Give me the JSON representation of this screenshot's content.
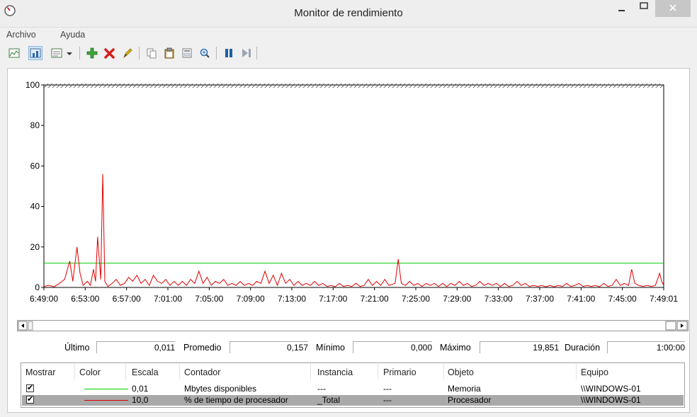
{
  "window": {
    "title": "Monitor de rendimiento"
  },
  "menu": [
    "Archivo",
    "Ayuda"
  ],
  "toolbar": {
    "icons": [
      "view-graph-icon",
      "view-histogram-icon",
      "view-report-icon",
      "dropdown-arrow-icon",
      "add-counter-icon",
      "delete-counter-icon",
      "highlight-icon",
      "copy-properties-icon",
      "paste-counter-list-icon",
      "properties-icon",
      "zoom-icon",
      "freeze-display-icon",
      "update-data-icon"
    ]
  },
  "chart_data": {
    "type": "line",
    "ylim": [
      0,
      100
    ],
    "yticks": [
      "0",
      "20",
      "40",
      "60",
      "80",
      "100"
    ],
    "xticks": [
      "6:49:00",
      "6:53:00",
      "6:57:00",
      "7:01:00",
      "7:05:00",
      "7:09:00",
      "7:13:00",
      "7:17:00",
      "7:21:00",
      "7:25:00",
      "7:29:00",
      "7:33:00",
      "7:37:00",
      "7:41:00",
      "7:45:00",
      "7:49:01"
    ],
    "series": [
      {
        "name": "Mbytes disponibles",
        "color": "#00cc00",
        "scale": "0,01",
        "values": [
          [
            0,
            12
          ],
          [
            60,
            12
          ]
        ]
      },
      {
        "name": "% de tiempo de procesador",
        "color": "#e00000",
        "scale": "10,0",
        "values": [
          [
            0,
            0.5
          ],
          [
            0.5,
            1
          ],
          [
            1,
            0.3
          ],
          [
            1.5,
            2
          ],
          [
            2,
            4
          ],
          [
            2.5,
            13
          ],
          [
            2.8,
            3
          ],
          [
            3.2,
            20
          ],
          [
            3.5,
            7
          ],
          [
            3.8,
            1
          ],
          [
            4.2,
            3
          ],
          [
            4.5,
            1
          ],
          [
            4.8,
            9
          ],
          [
            5,
            3
          ],
          [
            5.2,
            25
          ],
          [
            5.5,
            4
          ],
          [
            5.7,
            56
          ],
          [
            5.9,
            3
          ],
          [
            6.2,
            0.5
          ],
          [
            6.6,
            2
          ],
          [
            7,
            4
          ],
          [
            7.4,
            1
          ],
          [
            7.8,
            2
          ],
          [
            8.2,
            5
          ],
          [
            8.6,
            3
          ],
          [
            9,
            6
          ],
          [
            9.4,
            2
          ],
          [
            9.8,
            4
          ],
          [
            10.2,
            1
          ],
          [
            10.6,
            6
          ],
          [
            11,
            3
          ],
          [
            11.4,
            2
          ],
          [
            11.8,
            4
          ],
          [
            12.2,
            1
          ],
          [
            12.6,
            3
          ],
          [
            13,
            1
          ],
          [
            13.4,
            3
          ],
          [
            13.8,
            1
          ],
          [
            14.2,
            4
          ],
          [
            14.6,
            2
          ],
          [
            15,
            8
          ],
          [
            15.4,
            2
          ],
          [
            15.8,
            5
          ],
          [
            16.2,
            1
          ],
          [
            16.6,
            3
          ],
          [
            17,
            2
          ],
          [
            17.4,
            4
          ],
          [
            17.8,
            1
          ],
          [
            18.2,
            2
          ],
          [
            18.6,
            1
          ],
          [
            19,
            3
          ],
          [
            19.4,
            1
          ],
          [
            19.8,
            2
          ],
          [
            20.2,
            1
          ],
          [
            20.6,
            3
          ],
          [
            21,
            2
          ],
          [
            21.4,
            8
          ],
          [
            21.8,
            2
          ],
          [
            22.2,
            6
          ],
          [
            22.6,
            1
          ],
          [
            23,
            7
          ],
          [
            23.4,
            2
          ],
          [
            23.8,
            4
          ],
          [
            24.2,
            1
          ],
          [
            24.6,
            3
          ],
          [
            25,
            1
          ],
          [
            25.4,
            2
          ],
          [
            25.8,
            1
          ],
          [
            26.2,
            3
          ],
          [
            26.6,
            1
          ],
          [
            27,
            2
          ],
          [
            27.4,
            0.5
          ],
          [
            27.8,
            1
          ],
          [
            28.2,
            0.3
          ],
          [
            28.6,
            2
          ],
          [
            29,
            0.5
          ],
          [
            29.4,
            1
          ],
          [
            29.8,
            0.5
          ],
          [
            30.2,
            2
          ],
          [
            30.6,
            0.5
          ],
          [
            31,
            1
          ],
          [
            31.4,
            4
          ],
          [
            31.8,
            1
          ],
          [
            32.2,
            3
          ],
          [
            32.6,
            1
          ],
          [
            33,
            4
          ],
          [
            33.4,
            1
          ],
          [
            34,
            2
          ],
          [
            34.3,
            14
          ],
          [
            34.6,
            2
          ],
          [
            35,
            1
          ],
          [
            35.4,
            3
          ],
          [
            35.8,
            1
          ],
          [
            36.2,
            2
          ],
          [
            36.6,
            0.5
          ],
          [
            37,
            2
          ],
          [
            37.4,
            1
          ],
          [
            37.8,
            2
          ],
          [
            38.2,
            0.5
          ],
          [
            38.6,
            2
          ],
          [
            39,
            0.5
          ],
          [
            39.4,
            2
          ],
          [
            39.8,
            1
          ],
          [
            40.2,
            3
          ],
          [
            40.6,
            1
          ],
          [
            41,
            2
          ],
          [
            41.4,
            0.5
          ],
          [
            41.8,
            1
          ],
          [
            42.2,
            3
          ],
          [
            42.6,
            1
          ],
          [
            43,
            2
          ],
          [
            43.4,
            1
          ],
          [
            43.8,
            2
          ],
          [
            44.2,
            0.5
          ],
          [
            44.6,
            2
          ],
          [
            45,
            0.5
          ],
          [
            45.4,
            1
          ],
          [
            45.8,
            3
          ],
          [
            46.2,
            1
          ],
          [
            46.6,
            2
          ],
          [
            47,
            0.5
          ],
          [
            47.4,
            1
          ],
          [
            47.8,
            0.5
          ],
          [
            48.2,
            1
          ],
          [
            48.6,
            0.3
          ],
          [
            49,
            1
          ],
          [
            49.4,
            0.3
          ],
          [
            49.8,
            1
          ],
          [
            50.2,
            0.5
          ],
          [
            50.6,
            2
          ],
          [
            51,
            0.5
          ],
          [
            51.4,
            1
          ],
          [
            51.8,
            2
          ],
          [
            52.2,
            0.5
          ],
          [
            52.6,
            1
          ],
          [
            53,
            0.5
          ],
          [
            53.4,
            1
          ],
          [
            53.8,
            0.3
          ],
          [
            54.2,
            2
          ],
          [
            54.6,
            0.5
          ],
          [
            55,
            1
          ],
          [
            55.4,
            4
          ],
          [
            55.8,
            1
          ],
          [
            56.2,
            2
          ],
          [
            56.6,
            1
          ],
          [
            56.9,
            9
          ],
          [
            57.2,
            2
          ],
          [
            57.6,
            1
          ],
          [
            58,
            0.5
          ],
          [
            58.4,
            1
          ],
          [
            58.8,
            0.5
          ],
          [
            59.2,
            1
          ],
          [
            59.6,
            7
          ],
          [
            59.8,
            3
          ],
          [
            60,
            1
          ]
        ]
      }
    ]
  },
  "stats": {
    "last_label": "Último",
    "last": "0,011",
    "avg_label": "Promedio",
    "avg": "0,157",
    "min_label": "Mínimo",
    "min": "0,000",
    "max_label": "Máximo",
    "max": "19,851",
    "dur_label": "Duración",
    "dur": "1:00:00"
  },
  "legend": {
    "headers": {
      "show": "Mostrar",
      "color": "Color",
      "scale": "Escala",
      "counter": "Contador",
      "instance": "Instancia",
      "parent": "Primario",
      "object": "Objeto",
      "computer": "Equipo"
    },
    "rows": [
      {
        "checked": "✔",
        "color": "#00cc00",
        "scale": "0,01",
        "counter": "Mbytes disponibles",
        "instance": "---",
        "parent": "---",
        "object": "Memoria",
        "computer": "\\\\WINDOWS-01"
      },
      {
        "checked": "✔",
        "color": "#e00000",
        "scale": "10,0",
        "counter": "% de tiempo de procesador",
        "instance": "_Total",
        "parent": "---",
        "object": "Procesador",
        "computer": "\\\\WINDOWS-01"
      }
    ]
  }
}
